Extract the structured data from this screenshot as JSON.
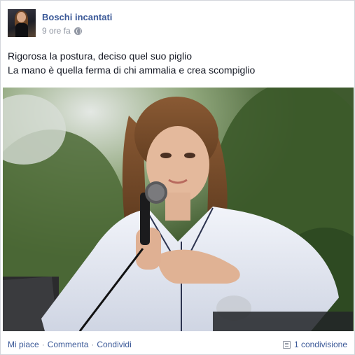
{
  "post": {
    "author": "Boschi incantati",
    "time": "9 ore fa",
    "privacy_icon": "globe-icon",
    "text_lines": [
      "Rigorosa la postura, deciso quel suo piglio",
      "La mano è quella ferma di chi ammalia e crea scompiglio"
    ],
    "photo_description_icon": "photo-icon"
  },
  "actions": {
    "like": "Mi piace",
    "comment": "Commenta",
    "share": "Condividi",
    "separator": "·"
  },
  "stats": {
    "shares": "1 condivisione"
  },
  "colors": {
    "link": "#3b5998",
    "meta": "#9197a3",
    "text": "#141823"
  }
}
